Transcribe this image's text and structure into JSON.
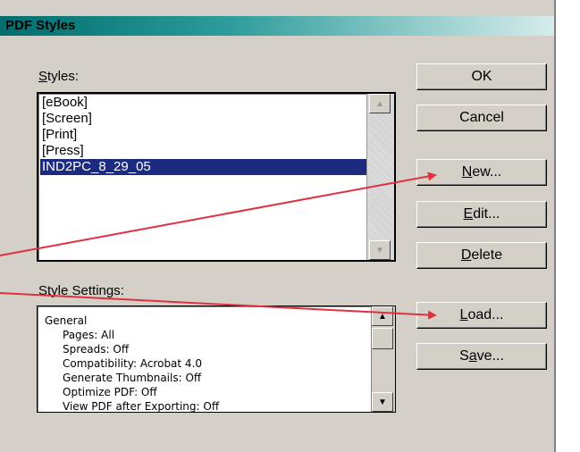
{
  "window": {
    "title": "PDF Styles"
  },
  "styles": {
    "label_mnemonic": "S",
    "label_rest": "tyles:",
    "items": [
      "[eBook]",
      "[Screen]",
      "[Print]",
      "[Press]",
      "IND2PC_8_29_05"
    ],
    "selected_index": 4
  },
  "settings": {
    "label": "Style Settings:",
    "lines": [
      "General",
      "Pages: All",
      "Spreads: Off",
      "Compatibility: Acrobat 4.0",
      "Generate Thumbnails: Off",
      "Optimize PDF: Off",
      "View PDF after Exporting: Off"
    ]
  },
  "buttons": {
    "ok": "OK",
    "cancel": "Cancel",
    "new_mnemonic": "N",
    "new_rest": "ew...",
    "edit_mnemonic": "E",
    "edit_rest": "dit...",
    "delete_mnemonic": "D",
    "delete_rest": "elete",
    "load_mnemonic": "L",
    "load_rest": "oad...",
    "save_pre": "S",
    "save_mnemonic": "a",
    "save_rest": "ve..."
  },
  "icons": {
    "scroll_up": "up-arrow-icon",
    "scroll_down": "down-arrow-icon"
  },
  "annotation_color": "#e03040"
}
